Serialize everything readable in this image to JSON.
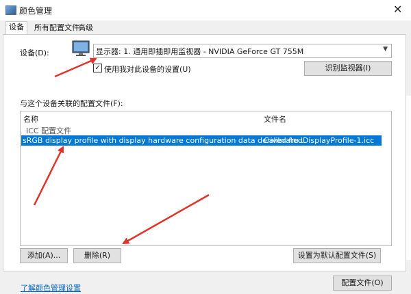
{
  "window": {
    "title": "颜色管理",
    "close_glyph": "✕"
  },
  "tabs": [
    {
      "label": "设备",
      "active": true
    },
    {
      "label": "所有配置文件",
      "active": false
    },
    {
      "label": "高级",
      "active": false
    }
  ],
  "device": {
    "label": "设备(D):",
    "monitor_icon": "monitor-icon",
    "selected": "显示器: 1. 通用即插即用监视器 - NVIDIA GeForce GT 755M",
    "use_settings_checkbox": {
      "checked": true,
      "label": "使用我对此设备的设置(U)"
    },
    "identify_button": "识别监视器(I)"
  },
  "profiles": {
    "section_label": "与这个设备关联的配置文件(F):",
    "columns": [
      "名称",
      "文件名"
    ],
    "group": "ICC 配置文件",
    "rows": [
      {
        "name": "sRGB display profile with display hardware configuration data derived fro...",
        "file": "CalibratedDisplayProfile-1.icc",
        "selected": true
      }
    ]
  },
  "buttons": {
    "add": "添加(A)...",
    "remove": "删除(R)",
    "set_default": "设置为默认配置文件(S)",
    "profiles": "配置文件(O)"
  },
  "footer_link": "了解颜色管理设置",
  "colors": {
    "selection": "#0078d7",
    "annotation_arrow": "#e0332a",
    "link": "#0066cc"
  }
}
